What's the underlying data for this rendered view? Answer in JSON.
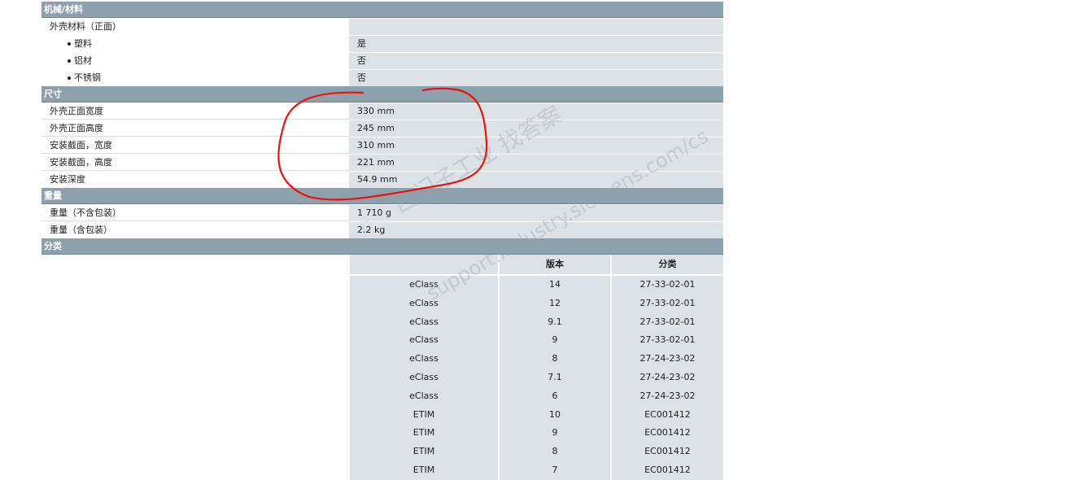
{
  "sections": {
    "material": {
      "title": "机械/材料",
      "housing_label": "外壳材料（正面）",
      "plastic_label": "塑料",
      "plastic_value": "是",
      "aluminum_label": "铝材",
      "aluminum_value": "否",
      "steel_label": "不锈钢",
      "steel_value": "否"
    },
    "dimensions": {
      "title": "尺寸",
      "rows": [
        {
          "label": "外壳正面宽度",
          "value": "330 mm"
        },
        {
          "label": "外壳正面高度",
          "value": "245 mm"
        },
        {
          "label": "安装截面，宽度",
          "value": "310 mm"
        },
        {
          "label": "安装截面，高度",
          "value": "221 mm"
        },
        {
          "label": "安装深度",
          "value": "54.9 mm"
        }
      ]
    },
    "weight": {
      "title": "重量",
      "rows": [
        {
          "label": "重量（不含包装）",
          "value": "1 710 g"
        },
        {
          "label": "重量（含包装）",
          "value": "2.2 kg"
        }
      ]
    },
    "classification": {
      "title": "分类",
      "headers": [
        "",
        "版本",
        "分类"
      ],
      "rows": [
        [
          "eClass",
          "14",
          "27-33-02-01"
        ],
        [
          "eClass",
          "12",
          "27-33-02-01"
        ],
        [
          "eClass",
          "9.1",
          "27-33-02-01"
        ],
        [
          "eClass",
          "9",
          "27-33-02-01"
        ],
        [
          "eClass",
          "8",
          "27-24-23-02"
        ],
        [
          "eClass",
          "7.1",
          "27-24-23-02"
        ],
        [
          "eClass",
          "6",
          "27-24-23-02"
        ],
        [
          "ETIM",
          "10",
          "EC001412"
        ],
        [
          "ETIM",
          "9",
          "EC001412"
        ],
        [
          "ETIM",
          "8",
          "EC001412"
        ],
        [
          "ETIM",
          "7",
          "EC001412"
        ]
      ]
    }
  },
  "watermark": {
    "line1": "西门子工业  找答案",
    "line2": "support.industry.siemens.com/cs"
  },
  "annotation_color": "#e8140c"
}
